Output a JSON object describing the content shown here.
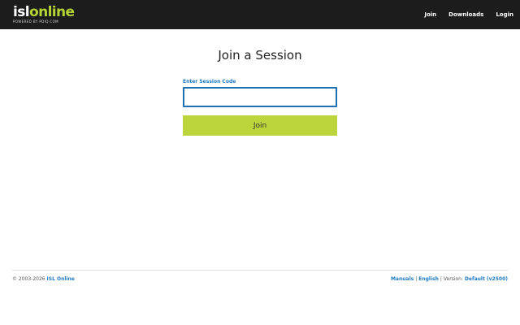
{
  "header": {
    "logo": {
      "part1": "isl",
      "part2": "online",
      "tagline": "POWERED BY PDIQ.COM"
    },
    "nav": [
      "Join",
      "Downloads",
      "Login"
    ],
    "background_color": "#1c1c1c",
    "logo_accent_color": "#b5d334"
  },
  "main": {
    "title": "Join a Session",
    "session_label": "Enter Session Code",
    "session_input_value": "",
    "join_button_label": "Join",
    "join_button_color": "#bcd53a",
    "input_border_color": "#1f6fb3"
  },
  "footer": {
    "copyright": "© 2003-2026",
    "company": "ISL Online",
    "manuals": "Manuals",
    "language": "English",
    "version_label": "Version:",
    "version_value": "Default (v2500)",
    "link_color": "#1f7ac1"
  }
}
